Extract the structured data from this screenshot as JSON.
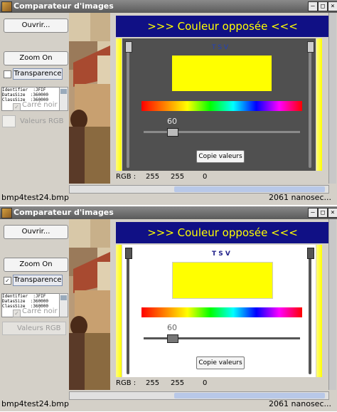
{
  "app_title": "Comparateur d'images",
  "window_buttons": [
    "–",
    "□",
    "×"
  ],
  "left_panel": {
    "open_button": "Ouvrir...",
    "zoom_button": "Zoom On",
    "transparency_label": "Transparence",
    "info_lines": [
      "Identifier  :JFIF",
      "DatasSize  :360000",
      "ClassSize  :360000"
    ],
    "black_square_label": "Carré noir",
    "rgb_values_label": "Valeurs RGB"
  },
  "right_panel": {
    "title": ">>> Couleur opposée <<<",
    "hsv_label": "T S V",
    "hue_value": "60",
    "copy_button": "Copie valeurs",
    "rgb_label": "RGB :",
    "rgb_values": [
      "255",
      "255",
      "0"
    ],
    "color_hex": "#ffff00",
    "panel_bg": "#505050"
  },
  "status": {
    "filename": "bmp4test24.bmp",
    "timing": "2061 nanosec..."
  },
  "windows": [
    {
      "transparency_checked": false
    },
    {
      "transparency_checked": true
    }
  ]
}
